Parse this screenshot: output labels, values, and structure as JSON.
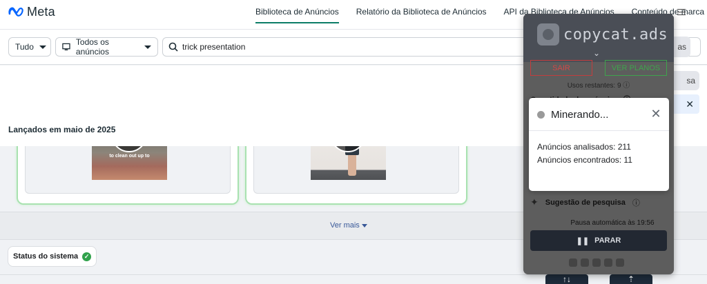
{
  "header": {
    "logo_text": "Meta",
    "nav": [
      {
        "label": "Biblioteca de Anúncios",
        "active": true
      },
      {
        "label": "Relatório da Biblioteca de Anúncios",
        "active": false
      },
      {
        "label": "API da Biblioteca de Anúncios",
        "active": false
      },
      {
        "label": "Conteúdo de marca",
        "active": false
      }
    ]
  },
  "filters": {
    "country": "Tudo",
    "ad_type": "Todos os anúncios",
    "search_value": "trick presentation",
    "right_partial": "as"
  },
  "results": {
    "launched_label": "Lançados em maio de 2025",
    "right_partial_1": "sa",
    "card1_caption": "to clean out up to",
    "see_more": "Ver mais"
  },
  "system_status": {
    "label": "Status do sistema"
  },
  "extension": {
    "brand": "copycat.ads",
    "logout": "SAIR",
    "plans": "VER PLANOS",
    "remaining_uses": "Usos restantes: 9",
    "ads_quantity_label": "Quantidade de anúncios:",
    "suggestion_label": "Sugestão de pesquisa",
    "auto_pause": "Pausa automática às 19:56",
    "stop_button": "PARAR"
  },
  "modal": {
    "title": "Minerando...",
    "analyzed": "Anúncios analisados: 211",
    "found": "Anúncios encontrados: 11"
  },
  "colors": {
    "accent": "#0a7c66",
    "card_border": "#a8e2b0",
    "stop_bg": "#222832"
  }
}
